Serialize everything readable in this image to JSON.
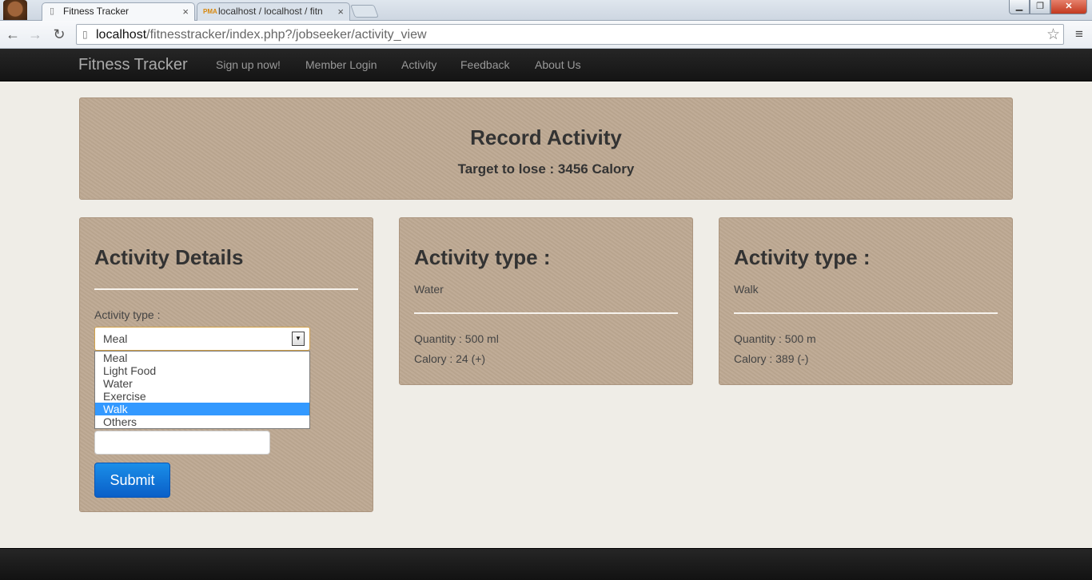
{
  "browser": {
    "tabs": [
      {
        "title": "Fitness Tracker",
        "close": "×"
      },
      {
        "title": "localhost / localhost / fitn",
        "icon_text": "PMA",
        "close": "×"
      }
    ],
    "window_controls": {
      "minimize": "▁",
      "maximize": "❐",
      "close": "✕"
    },
    "nav": {
      "back": "←",
      "forward": "→",
      "reload": "↻",
      "menu": "≡",
      "star": "☆"
    },
    "url": {
      "host": "localhost",
      "path": "/fitnesstracker/index.php?/jobseeker/activity_view"
    }
  },
  "navbar": {
    "brand": "Fitness Tracker",
    "links": [
      "Sign up now!",
      "Member Login",
      "Activity",
      "Feedback",
      "About Us"
    ]
  },
  "hero": {
    "title": "Record Activity",
    "subtitle": "Target to lose : 3456 Calory"
  },
  "form": {
    "heading": "Activity Details",
    "activity_type_label": "Activity type :",
    "select_value": "Meal",
    "options": [
      "Meal",
      "Light Food",
      "Water",
      "Exercise",
      "Walk",
      "Others"
    ],
    "highlighted_option": "Walk",
    "input_value": "",
    "submit_label": "Submit"
  },
  "activities": [
    {
      "heading": "Activity type :",
      "type": "Water",
      "quantity": "Quantity : 500 ml",
      "calory": "Calory : 24 (+)"
    },
    {
      "heading": "Activity type :",
      "type": "Walk",
      "quantity": "Quantity : 500 m",
      "calory": "Calory : 389 (-)"
    }
  ],
  "colors": {
    "panel": "#bea993",
    "navbar": "#1c1c1c",
    "page_bg": "#efede7",
    "submit": "#0e74d8",
    "option_highlight": "#3399ff"
  },
  "icons": [
    "page-icon",
    "pma-icon",
    "back-arrow-icon",
    "forward-arrow-icon",
    "reload-icon",
    "star-icon",
    "menu-icon",
    "dropdown-arrow-icon"
  ]
}
